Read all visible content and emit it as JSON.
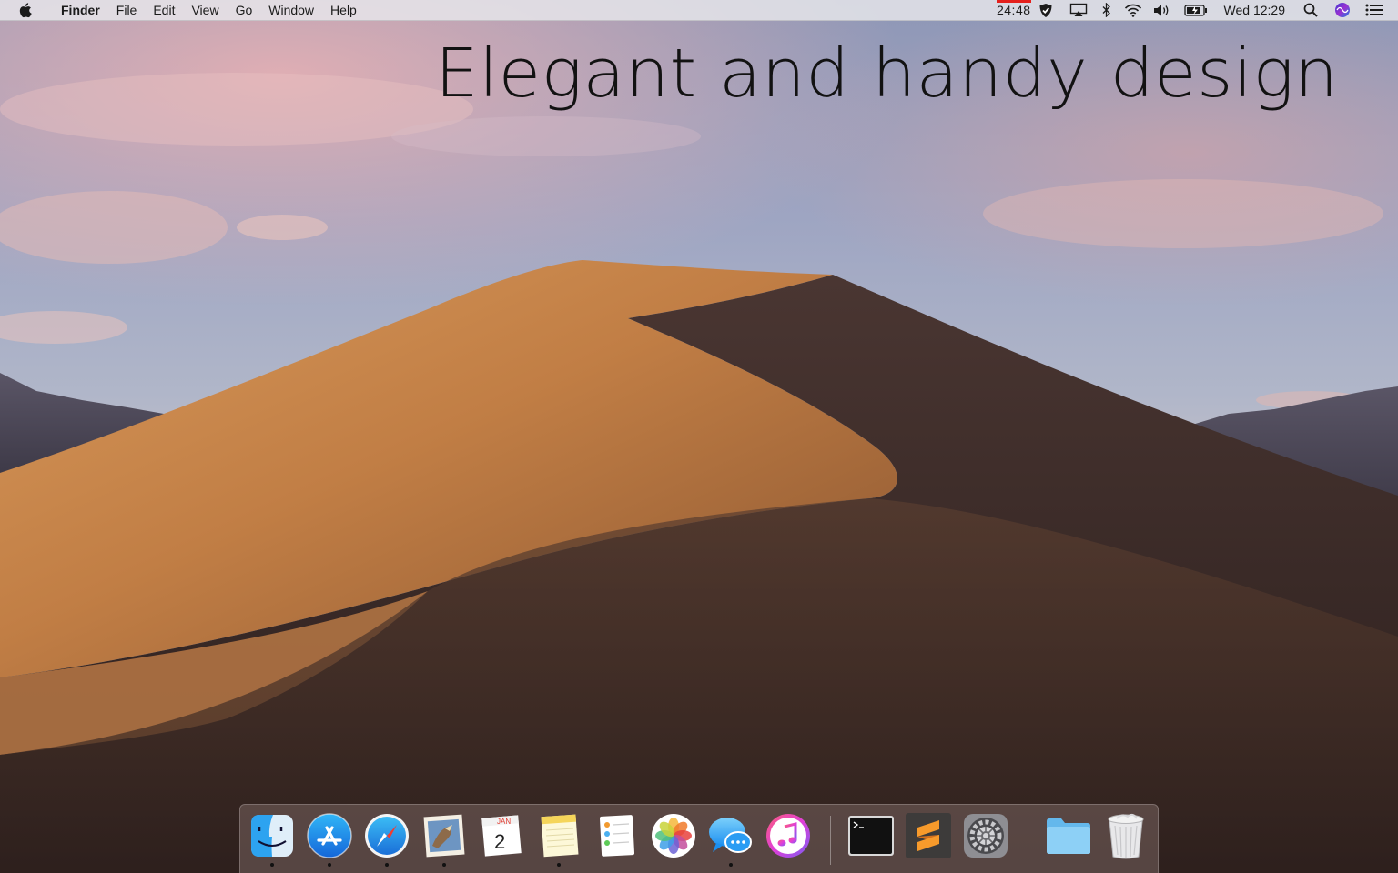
{
  "menubar": {
    "app_name": "Finder",
    "menus": [
      "File",
      "Edit",
      "View",
      "Go",
      "Window",
      "Help"
    ],
    "timer": "24:48",
    "clock": "Wed 12:29",
    "status_icons": [
      "shield-icon",
      "airplay-icon",
      "bluetooth-icon",
      "wifi-icon",
      "volume-icon",
      "battery-icon",
      "search-icon",
      "siri-icon",
      "notification-center-icon"
    ]
  },
  "headline": "Elegant and handy design",
  "dock": {
    "calendar_month": "JAN",
    "calendar_day": "2",
    "apps": [
      {
        "name": "finder-icon",
        "running": true
      },
      {
        "name": "app-store-icon",
        "running": true
      },
      {
        "name": "safari-icon",
        "running": true
      },
      {
        "name": "mail-icon",
        "running": true
      },
      {
        "name": "calendar-icon",
        "running": false
      },
      {
        "name": "notes-icon",
        "running": true
      },
      {
        "name": "reminders-icon",
        "running": false
      },
      {
        "name": "photos-icon",
        "running": false
      },
      {
        "name": "messages-icon",
        "running": true
      },
      {
        "name": "itunes-icon",
        "running": false
      },
      {
        "name": "terminal-icon",
        "running": false
      },
      {
        "name": "sublime-text-icon",
        "running": false
      },
      {
        "name": "system-preferences-icon",
        "running": false
      },
      {
        "name": "folder-icon",
        "running": false
      },
      {
        "name": "trash-icon",
        "running": false
      }
    ]
  },
  "colors": {
    "timer_bar": "#e4201c",
    "dune_light": "#c98a4e",
    "dune_dark": "#3c2a26"
  }
}
